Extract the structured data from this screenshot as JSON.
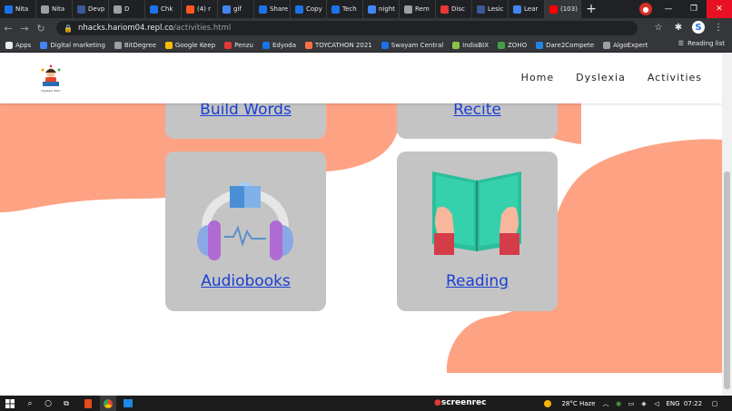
{
  "browser": {
    "tabs": [
      {
        "label": "Nita",
        "color": "#1a73e8"
      },
      {
        "label": "Nita",
        "color": "#9aa0a6"
      },
      {
        "label": "Devp",
        "color": "#3b5998"
      },
      {
        "label": "D",
        "color": "#9aa0a6"
      },
      {
        "label": "Chk",
        "color": "#1a73e8"
      },
      {
        "label": "(4) r",
        "color": "#ff5722"
      },
      {
        "label": "gif",
        "color": "#4285f4"
      },
      {
        "label": "Share",
        "color": "#1a73e8"
      },
      {
        "label": "Copy",
        "color": "#1a73e8"
      },
      {
        "label": "Tech",
        "color": "#1a73e8"
      },
      {
        "label": "night",
        "color": "#4285f4"
      },
      {
        "label": "Rem",
        "color": "#9aa0a6"
      },
      {
        "label": "Disc",
        "color": "#e53935"
      },
      {
        "label": "Lesic",
        "color": "#3b5998"
      },
      {
        "label": "Lear",
        "color": "#4285f4"
      },
      {
        "label": "(103)",
        "color": "#ff0000"
      }
    ],
    "new_tab": "+",
    "window_controls": {
      "minimize": "—",
      "restore": "❐",
      "close": "✕"
    },
    "address": {
      "host": "nhacks.hariom04.repl.co",
      "path": "/activities.html"
    },
    "bookmarks": [
      {
        "label": "Apps",
        "color": "#e8eaed"
      },
      {
        "label": "Digital marketing",
        "color": "#4285f4"
      },
      {
        "label": "BitDegree",
        "color": "#9aa0a6"
      },
      {
        "label": "Google Keep",
        "color": "#fbbc04"
      },
      {
        "label": "Penzu",
        "color": "#e53935"
      },
      {
        "label": "Edyoda",
        "color": "#1a73e8"
      },
      {
        "label": "TOYCATHON 2021",
        "color": "#ff7043"
      },
      {
        "label": "Swayam Central",
        "color": "#1a73e8"
      },
      {
        "label": "IndiaBIX",
        "color": "#8bc34a"
      },
      {
        "label": "ZOHO",
        "color": "#43a047"
      },
      {
        "label": "Dare2Compete",
        "color": "#1e88e5"
      },
      {
        "label": "AlgoExpert",
        "color": "#9aa0a6"
      }
    ],
    "reading_list": "Reading list"
  },
  "site": {
    "logo_caption": "Dyslexia Tutor",
    "nav": {
      "home": "Home",
      "dyslexia": "Dyslexia",
      "activities": "Activities"
    },
    "cards": {
      "build_words": "Build Words",
      "recite": "Recite",
      "audiobooks": "Audiobooks",
      "reading": "Reading"
    },
    "colors": {
      "blob": "#fda384",
      "card": "#c4c4c4",
      "link": "#1a3fd4"
    }
  },
  "taskbar": {
    "recorder": "screenrec",
    "weather": "28°C  Haze",
    "language": "ENG",
    "time": "07:22"
  }
}
